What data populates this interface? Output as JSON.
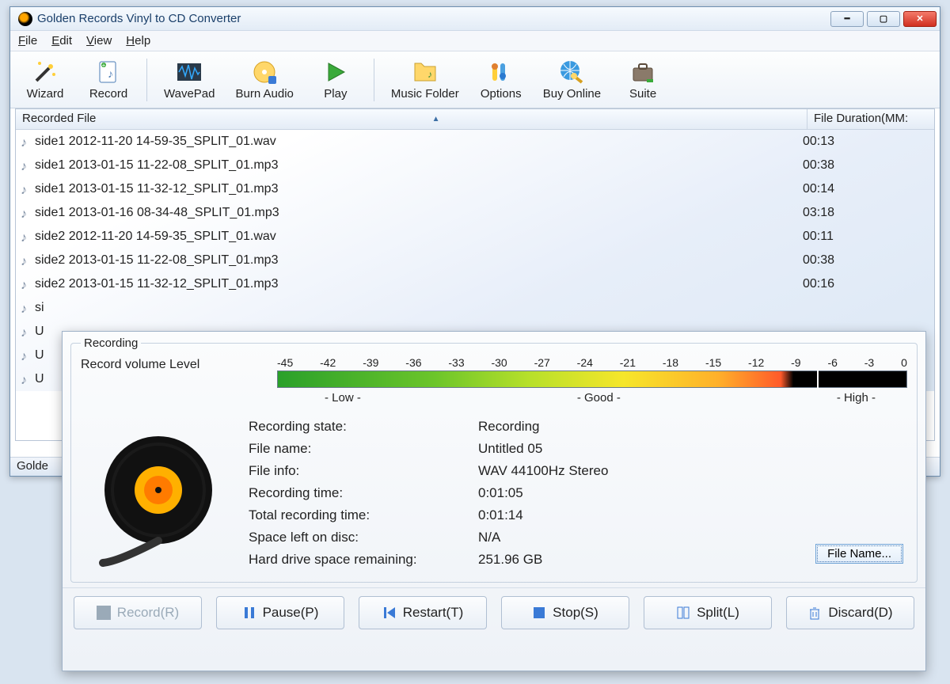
{
  "window": {
    "title": "Golden Records Vinyl to CD Converter"
  },
  "menubar": [
    "File",
    "Edit",
    "View",
    "Help"
  ],
  "toolbar": [
    {
      "label": "Wizard",
      "icon": "wand"
    },
    {
      "label": "Record",
      "icon": "record-doc"
    },
    {
      "label": "WavePad",
      "icon": "waveform",
      "sep_before": true
    },
    {
      "label": "Burn Audio",
      "icon": "burn-cd"
    },
    {
      "label": "Play",
      "icon": "play"
    },
    {
      "label": "Music Folder",
      "icon": "folder-music",
      "sep_before": true
    },
    {
      "label": "Options",
      "icon": "options"
    },
    {
      "label": "Buy Online",
      "icon": "globe-key"
    },
    {
      "label": "Suite",
      "icon": "suitcase"
    }
  ],
  "list": {
    "col1": "Recorded File",
    "col2": "File Duration(MM:",
    "rows": [
      {
        "name": "side1 2012-11-20 14-59-35_SPLIT_01.wav",
        "dur": "00:13"
      },
      {
        "name": "side1 2013-01-15 11-22-08_SPLIT_01.mp3",
        "dur": "00:38"
      },
      {
        "name": "side1 2013-01-15 11-32-12_SPLIT_01.mp3",
        "dur": "00:14"
      },
      {
        "name": "side1 2013-01-16 08-34-48_SPLIT_01.mp3",
        "dur": "03:18"
      },
      {
        "name": "side2 2012-11-20 14-59-35_SPLIT_01.wav",
        "dur": "00:11"
      },
      {
        "name": "side2 2013-01-15 11-22-08_SPLIT_01.mp3",
        "dur": "00:38"
      },
      {
        "name": "side2 2013-01-15 11-32-12_SPLIT_01.mp3",
        "dur": "00:16"
      },
      {
        "name": "si",
        "dur": ""
      },
      {
        "name": "U",
        "dur": ""
      },
      {
        "name": "U",
        "dur": ""
      },
      {
        "name": "U",
        "dur": ""
      }
    ]
  },
  "statusbar": "Golde",
  "dialog": {
    "legend": "Recording",
    "meter_label": "Record volume Level",
    "ticks": [
      "-45",
      "-42",
      "-39",
      "-36",
      "-33",
      "-30",
      "-27",
      "-24",
      "-21",
      "-18",
      "-15",
      "-12",
      "-9",
      "-6",
      "-3",
      "0"
    ],
    "zones": {
      "low": "- Low -",
      "good": "- Good -",
      "high": "- High -"
    },
    "info_labels": {
      "state": "Recording state:",
      "fname": "File name:",
      "finfo": "File info:",
      "rectime": "Recording time:",
      "tottime": "Total recording time:",
      "disc": "Space left on disc:",
      "hdd": "Hard drive space remaining:"
    },
    "info_values": {
      "state": "Recording",
      "fname": "Untitled 05",
      "finfo": "WAV 44100Hz Stereo",
      "rectime": "0:01:05",
      "tottime": "0:01:14",
      "disc": "N/A",
      "hdd": "251.96 GB"
    },
    "file_name_btn": "File Name...",
    "buttons": [
      {
        "label": "Record(R)",
        "icon": "rec",
        "disabled": true
      },
      {
        "label": "Pause(P)",
        "icon": "pause"
      },
      {
        "label": "Restart(T)",
        "icon": "restart"
      },
      {
        "label": "Stop(S)",
        "icon": "stop"
      },
      {
        "label": "Split(L)",
        "icon": "split"
      },
      {
        "label": "Discard(D)",
        "icon": "discard"
      }
    ]
  }
}
